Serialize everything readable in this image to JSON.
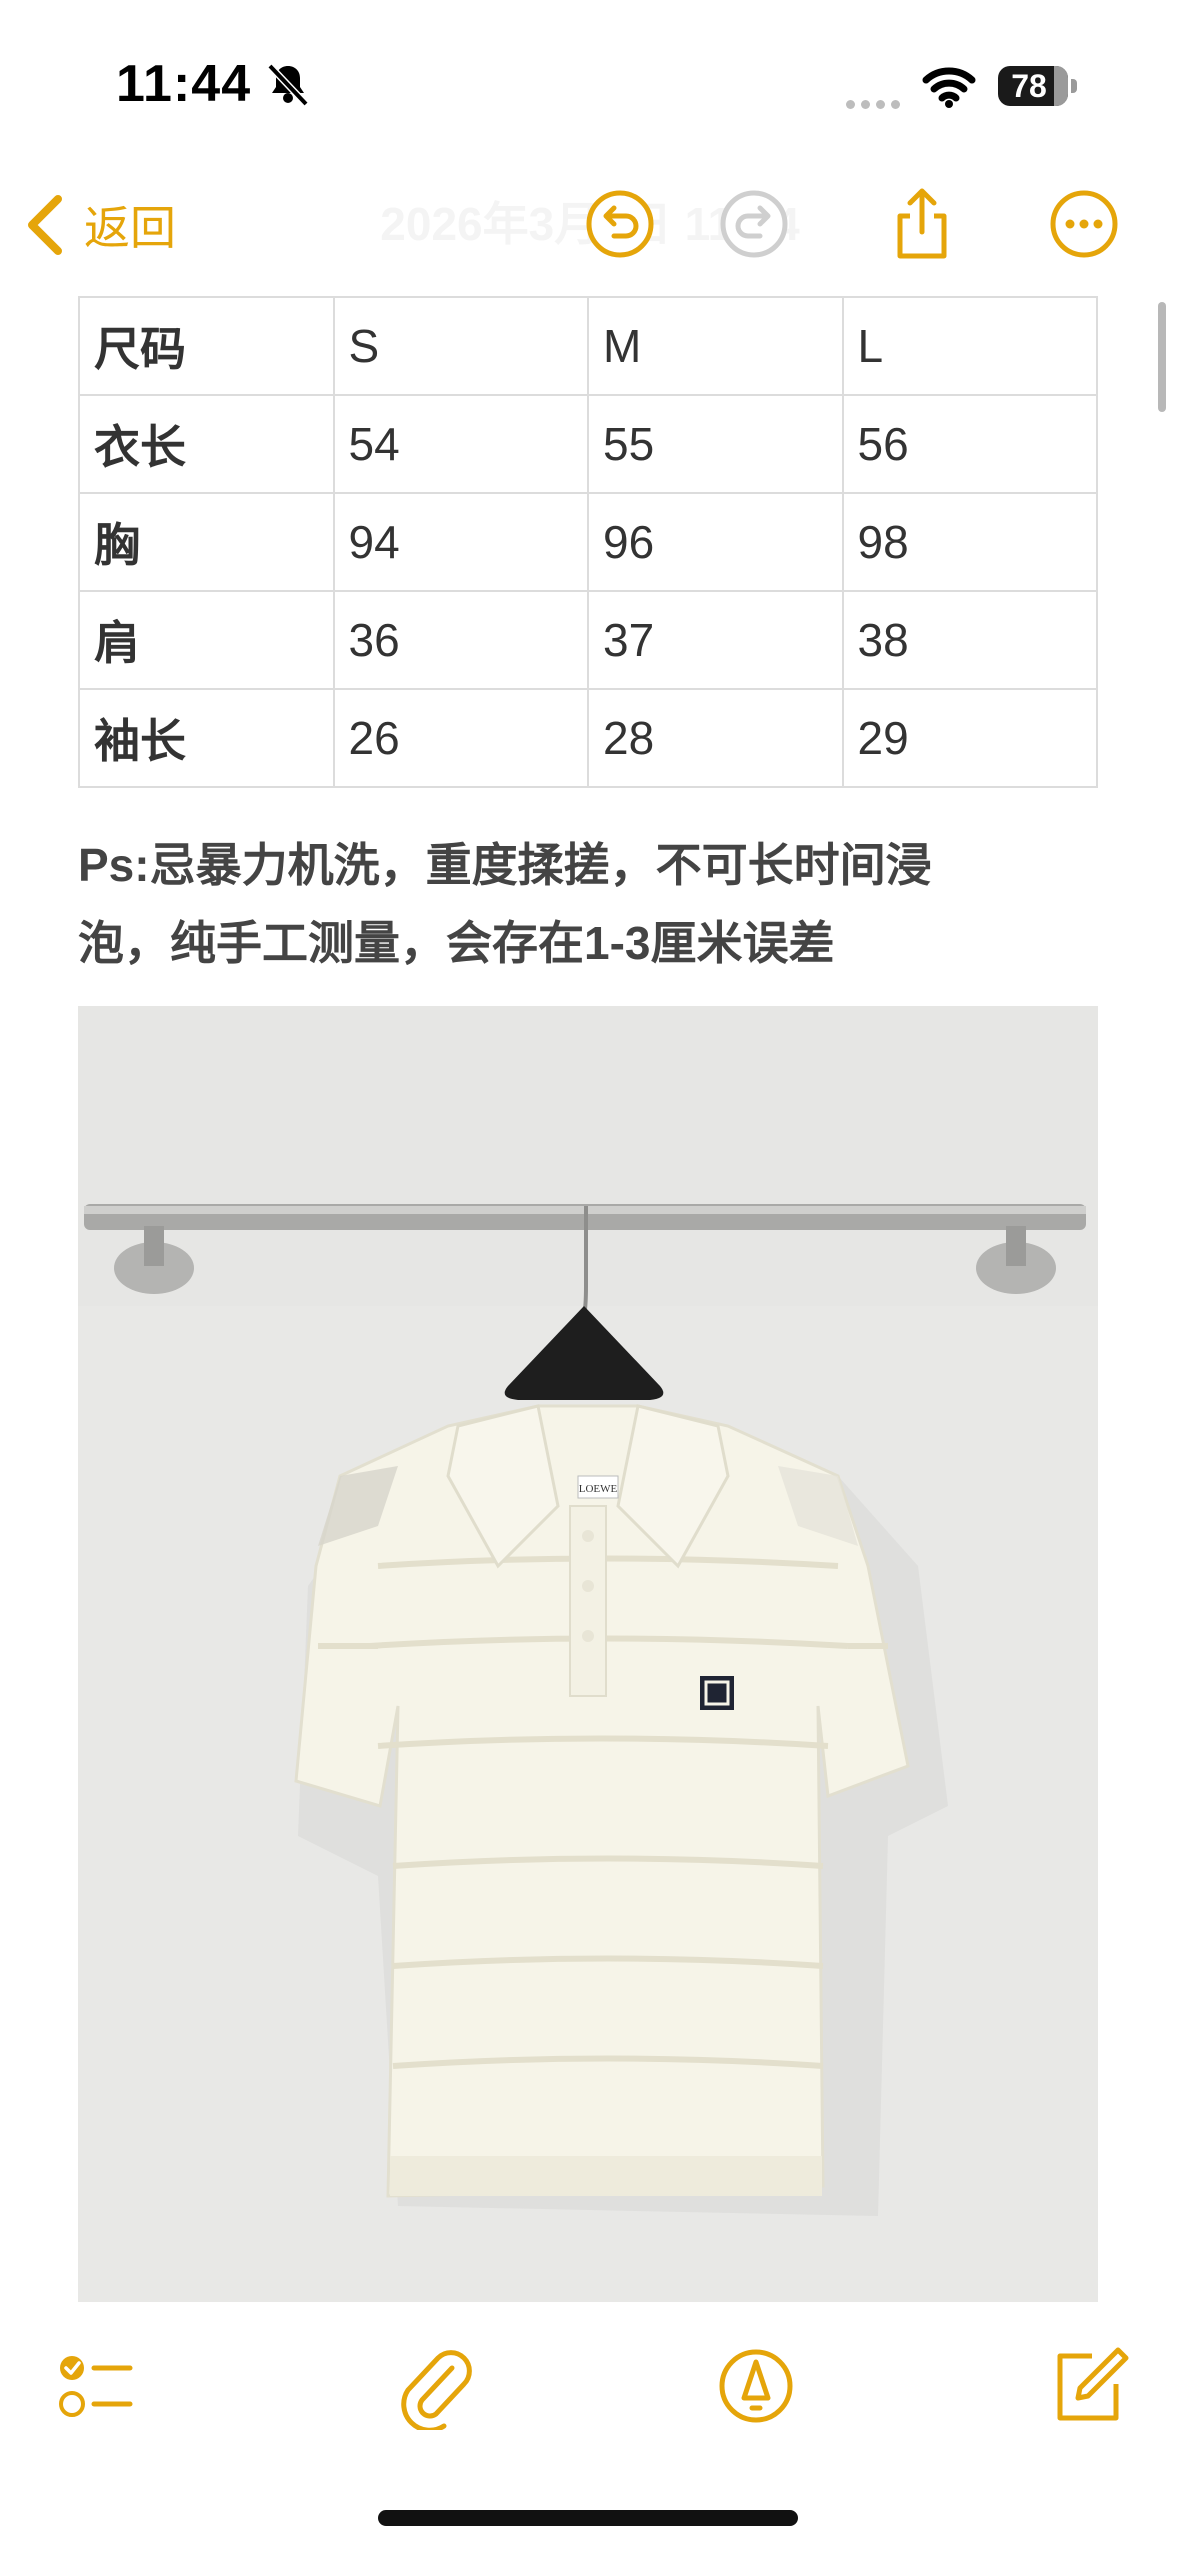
{
  "status_bar": {
    "time": "11:44",
    "battery": "78"
  },
  "nav": {
    "back_label": "返回",
    "title": "2026年3月8日 11:44"
  },
  "table": {
    "rows": [
      [
        "尺码",
        "S",
        "M",
        "L"
      ],
      [
        "衣长",
        "54",
        "55",
        "56"
      ],
      [
        "胸",
        "94",
        "96",
        "98"
      ],
      [
        "肩",
        "36",
        "37",
        "38"
      ],
      [
        "袖长",
        "26",
        "28",
        "29"
      ]
    ]
  },
  "note": {
    "line1": "Ps:忌暴力机洗，重度揉搓，不可长时间浸",
    "line2": "泡，纯手工测量，会存在1-3厘米误差"
  },
  "photo": {
    "label_text": "LOEWE"
  },
  "colors": {
    "accent": "#e5a50a",
    "table_border": "#dcdcdc",
    "text": "#333333"
  },
  "icons": {
    "nav": [
      "chevron-left-icon",
      "undo-icon",
      "redo-icon",
      "share-icon",
      "more-icon"
    ],
    "toolbar": [
      "checklist-icon",
      "paperclip-icon",
      "markup-pen-icon",
      "compose-icon"
    ]
  }
}
